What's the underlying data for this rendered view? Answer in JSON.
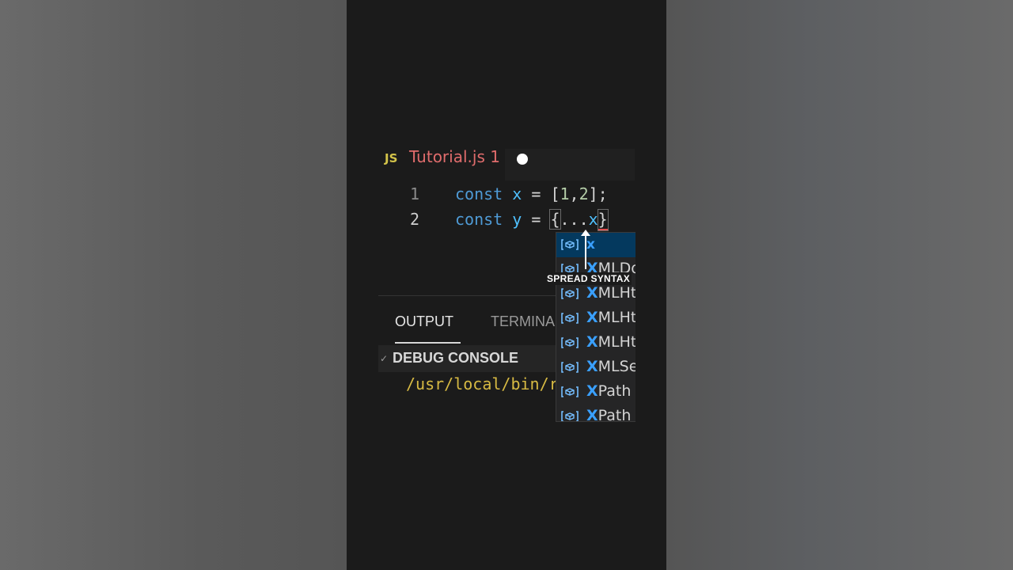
{
  "editor": {
    "tab": {
      "lang_badge": "JS",
      "filename": "Tutorial.js",
      "problems": "1"
    },
    "lines": [
      {
        "number": "1",
        "kw": "const",
        "name": "x",
        "eq": "=",
        "rest_open": "[",
        "n1": "1",
        "comma": ",",
        "n2": "2",
        "rest_close": "];"
      },
      {
        "number": "2",
        "kw": "const",
        "name": "y",
        "eq": "=",
        "brace_open": "{",
        "spread": "...",
        "ref": "x",
        "brace_close": "}"
      }
    ]
  },
  "suggestions": [
    {
      "match": "x",
      "rest": ""
    },
    {
      "match": "X",
      "rest": "MLDo"
    },
    {
      "match": "X",
      "rest": "MLHt"
    },
    {
      "match": "X",
      "rest": "MLHt"
    },
    {
      "match": "X",
      "rest": "MLHt"
    },
    {
      "match": "X",
      "rest": "MLSe"
    },
    {
      "match": "X",
      "rest": "Path"
    },
    {
      "match": "X",
      "rest": "Path"
    }
  ],
  "annotation": {
    "label": "SPREAD SYNTAX"
  },
  "panel": {
    "tabs": {
      "output": "OUTPUT",
      "terminal": "TERMINA"
    },
    "debug_console": "DEBUG CONSOLE",
    "debug_chevron": "✓",
    "path_text": "/usr/local/bin/r"
  },
  "colors": {
    "keyword": "#4f9bd6",
    "variable": "#4fc1ff",
    "number": "#b5cea8",
    "path": "#d7ba43",
    "tab_error": "#e06c6c",
    "selection": "#04395e"
  }
}
